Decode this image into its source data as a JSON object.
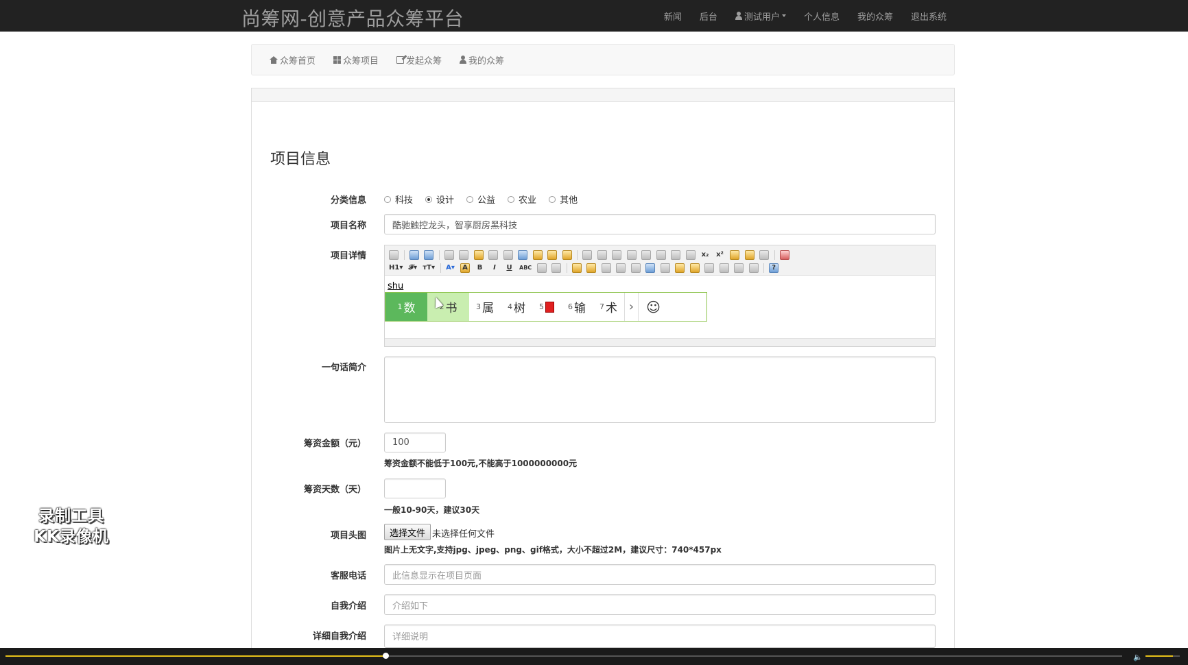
{
  "navbar": {
    "brand": "尚筹网-创意产品众筹平台",
    "links": [
      "新闻",
      "后台",
      "测试用户",
      "个人信息",
      "我的众筹",
      "退出系统"
    ]
  },
  "subnav": {
    "items": [
      "众筹首页",
      "众筹项目",
      "发起众筹",
      "我的众筹"
    ]
  },
  "form": {
    "title": "项目信息",
    "category": {
      "label": "分类信息",
      "options": [
        "科技",
        "设计",
        "公益",
        "农业",
        "其他"
      ],
      "selected": "设计"
    },
    "name": {
      "label": "项目名称",
      "value": "酷驰触控龙头，智享厨房黑科技"
    },
    "detail": {
      "label": "项目详情",
      "typed": "shu"
    },
    "ime": {
      "candidates": [
        {
          "n": "1",
          "text": "数"
        },
        {
          "n": "2",
          "text": "书"
        },
        {
          "n": "3",
          "text": "属"
        },
        {
          "n": "4",
          "text": "树"
        },
        {
          "n": "5",
          "text": ""
        },
        {
          "n": "6",
          "text": "输"
        },
        {
          "n": "7",
          "text": "术"
        }
      ],
      "next_icon": "chevron-right-icon",
      "emoji_icon": "smiley-icon"
    },
    "summary": {
      "label": "一句话简介"
    },
    "amount": {
      "label": "筹资金额（元）",
      "value": "100",
      "help": "筹资金额不能低于100元,不能高于1000000000元"
    },
    "days": {
      "label": "筹资天数（天）",
      "value": "",
      "help": "一般10-90天，建议30天"
    },
    "image": {
      "label": "项目头图",
      "button": "选择文件",
      "none": "未选择任何文件",
      "help": "图片上无文字,支持jpg、jpeg、png、gif格式，大小不超过2M，建议尺寸：740*457px"
    },
    "phone": {
      "label": "客服电话",
      "placeholder": "此信息显示在项目页面"
    },
    "intro": {
      "label": "自我介绍",
      "placeholder": "介绍如下"
    },
    "detail_intro": {
      "label": "详细自我介绍",
      "placeholder": "详细说明"
    }
  },
  "watermark": {
    "line1": "录制工具",
    "line2": "KK录像机"
  },
  "video": {
    "progress": 0.34,
    "volume": 0.8
  },
  "colors": {
    "navbar": "#222222",
    "ime_selected": "#5cb85c",
    "progress": "#e8c21a"
  }
}
